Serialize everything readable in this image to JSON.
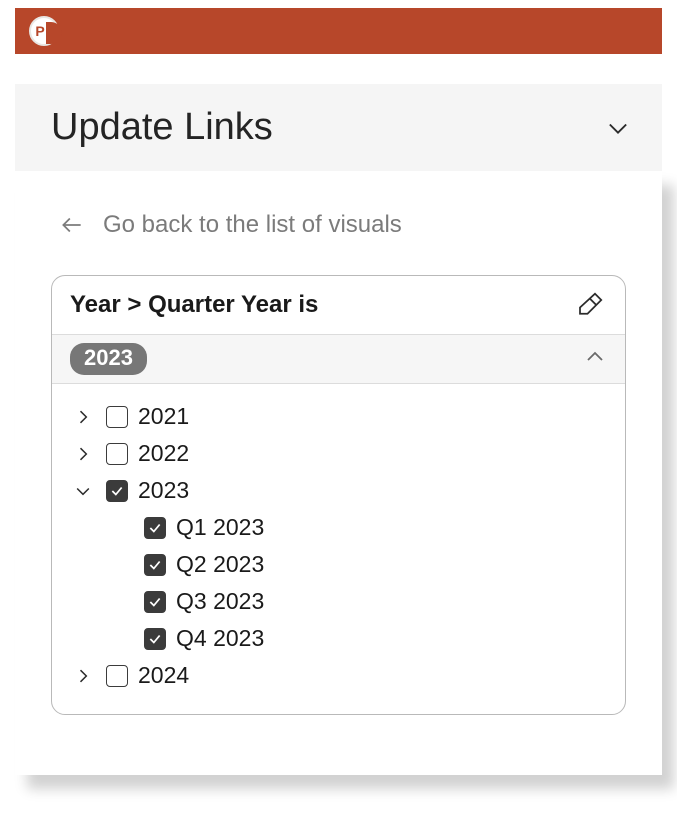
{
  "app": {
    "name": "PowerPoint"
  },
  "pane": {
    "title": "Update Links"
  },
  "back": {
    "label": "Go back to the list of visuals"
  },
  "filter": {
    "title": "Year > Quarter Year is",
    "badge": "2023"
  },
  "tree": {
    "items": [
      {
        "label": "2021",
        "checked": false,
        "expanded": false,
        "level": 0
      },
      {
        "label": "2022",
        "checked": false,
        "expanded": false,
        "level": 0
      },
      {
        "label": "2023",
        "checked": true,
        "expanded": true,
        "level": 0
      },
      {
        "label": "Q1 2023",
        "checked": true,
        "level": 1
      },
      {
        "label": "Q2 2023",
        "checked": true,
        "level": 1
      },
      {
        "label": "Q3 2023",
        "checked": true,
        "level": 1
      },
      {
        "label": "Q4 2023",
        "checked": true,
        "level": 1
      },
      {
        "label": "2024",
        "checked": false,
        "expanded": false,
        "level": 0
      }
    ]
  }
}
